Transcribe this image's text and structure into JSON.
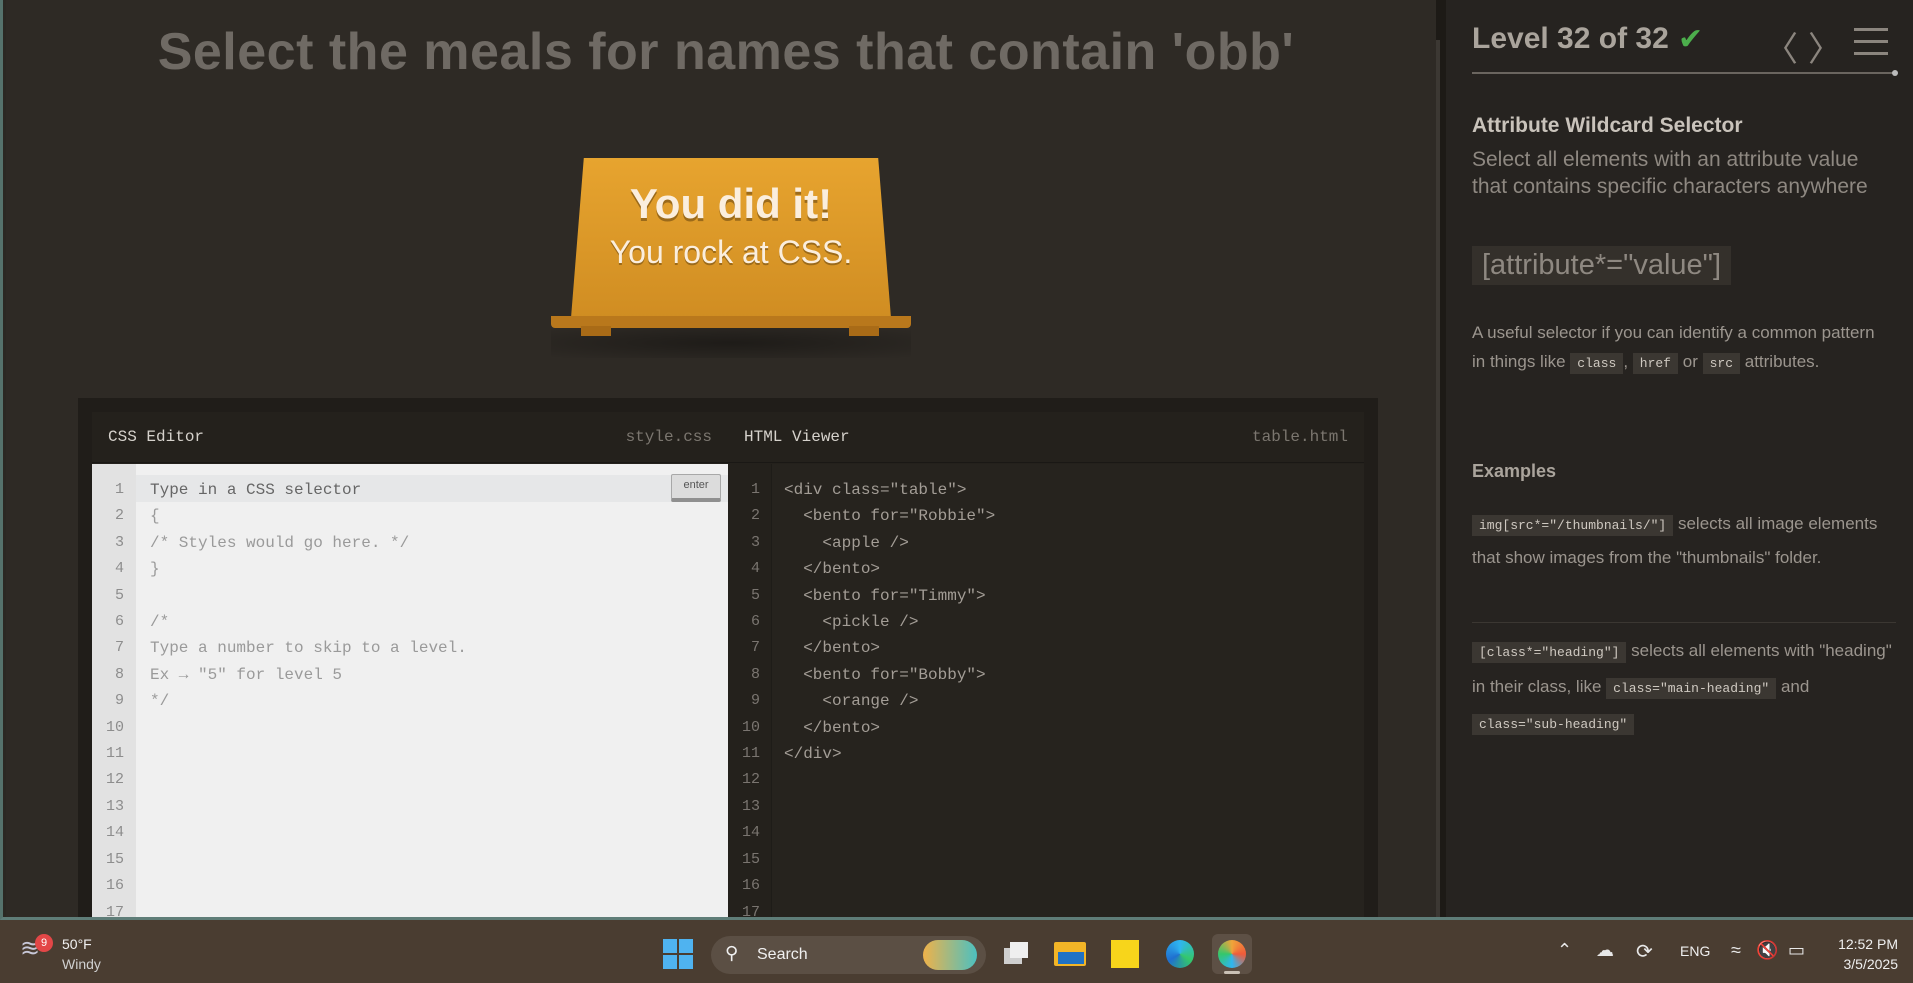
{
  "game": {
    "instruction": "Select the meals for names that contain 'obb'",
    "win_title": "You did it!",
    "win_subtitle": "You rock at CSS."
  },
  "css_editor": {
    "title": "CSS Editor",
    "filename": "style.css",
    "input_placeholder": "Type in a CSS selector",
    "enter_label": "enter",
    "line_numbers": "1\n2\n3\n4\n5\n6\n7\n8\n9\n10\n11\n12\n13\n14\n15\n16\n17",
    "lines": [
      "{",
      "/* Styles would go here. */",
      "}",
      "",
      "/*",
      "Type a number to skip to a level.",
      "Ex → \"5\" for level 5",
      "*/"
    ]
  },
  "html_viewer": {
    "title": "HTML Viewer",
    "filename": "table.html",
    "line_numbers": "1\n2\n3\n4\n5\n6\n7\n8\n9\n10\n11\n12\n13\n14\n15\n16\n17",
    "lines": [
      "<div class=\"table\">",
      "  <bento for=\"Robbie\">",
      "    <apple />",
      "  </bento>",
      "  <bento for=\"Timmy\">",
      "    <pickle />",
      "  </bento>",
      "  <bento for=\"Bobby\">",
      "    <orange />",
      "  </bento>",
      "</div>"
    ]
  },
  "sidebar": {
    "level_label": "Level 32 of 32",
    "check_icon": "✔",
    "prev_icon": "〈",
    "next_icon": "〉",
    "selector_name": "Attribute Wildcard Selector",
    "selector_title": "Select all elements with an attribute value that contains specific characters anywhere",
    "syntax": "[attribute*=\"value\"]",
    "hint_prefix": "A useful selector if you can identify a common pattern in things like",
    "hint_code_1": "class",
    "hint_sep_1": ",",
    "hint_code_2": "href",
    "hint_sep_2": "or",
    "hint_code_3": "src",
    "hint_suffix": "attributes.",
    "examples_title": "Examples",
    "example_1_code": "img[src*=\"/thumbnails/\"]",
    "example_1_text": "selects all image elements that show images from the \"thumbnails\" folder.",
    "example_2_code": "[class*=\"heading\"]",
    "example_2_text_a": "selects all elements with \"heading\" in their class, like",
    "example_2_code_2": "class=\"main-heading\"",
    "example_2_text_b": "and",
    "example_2_code_3": "class=\"sub-heading\""
  },
  "taskbar": {
    "weather_badge": "9",
    "weather_temp": "50°F",
    "weather_desc": "Windy",
    "search_label": "Search",
    "tray_lang": "ENG",
    "clock_time": "12:52 PM",
    "clock_date": "3/5/2025"
  },
  "colors": {
    "accent_orange": "#e7a42f",
    "check_green": "#4cae4c",
    "panel_bg": "#2e2a25"
  }
}
